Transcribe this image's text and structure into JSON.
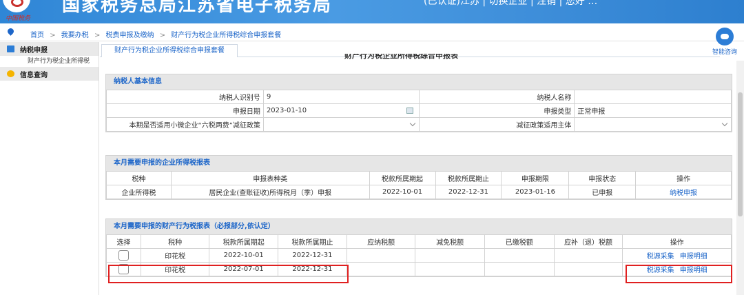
{
  "banner": {
    "logo_text": "中国税务",
    "title": "国家税务总局江苏省电子税务局",
    "top_links": "(已认证)江苏 | 切换企业 | 注销 | 您好 …"
  },
  "breadcrumb": [
    "首页",
    ">",
    "我要办税",
    ">",
    "税费申报及缴纳",
    ">",
    "财产行为税企业所得税综合申报套餐"
  ],
  "sidebar": {
    "nav1": "纳税申报",
    "nav1_sub": "财产行为税企业所得税",
    "nav2": "信息查询"
  },
  "tab_label": "财产行为税企业所得税综合申报套餐",
  "cut_title": "财产行为税企业所得税综合申报表",
  "assistant_label": "智能咨询",
  "basic": {
    "header": "纳税人基本信息",
    "id_label": "纳税人识别号",
    "id_value": "9",
    "name_label": "纳税人名称",
    "name_value": "",
    "date_label": "申报日期",
    "date_value": "2023-01-10",
    "type_label": "申报类型",
    "type_value": "正常申报",
    "policy_label": "本期是否适用小微企业“六税两费”减征政策",
    "policy_value": "",
    "subject_label": "减征政策适用主体",
    "subject_value": ""
  },
  "income": {
    "header": "本月需要申报的企业所得税报表",
    "cols": [
      "税种",
      "申报表种类",
      "税款所属期起",
      "税款所属期止",
      "申报期限",
      "申报状态",
      "操作"
    ],
    "row": [
      "企业所得税",
      "居民企业(查账征收)所得税月（季）申报",
      "2022-10-01",
      "2022-12-31",
      "2023-01-16",
      "已申报"
    ],
    "action": "纳税申报"
  },
  "property": {
    "header": "本月需要申报的财产行为税报表（必报部分,依认定）",
    "cols": [
      "选择",
      "税种",
      "税款所属期起",
      "税款所属期止",
      "应纳税额",
      "减免税额",
      "已缴税额",
      "应补（退）税额",
      "操作"
    ],
    "rows": [
      [
        "印花税",
        "2022-10-01",
        "2022-12-31"
      ],
      [
        "印花税",
        "2022-07-01",
        "2022-12-31"
      ]
    ],
    "action1": "税源采集",
    "action2": "申报明细"
  },
  "colors": {
    "accent": "#1d66c9",
    "highlight": "#e02020",
    "banner": "#3a8fdc"
  }
}
